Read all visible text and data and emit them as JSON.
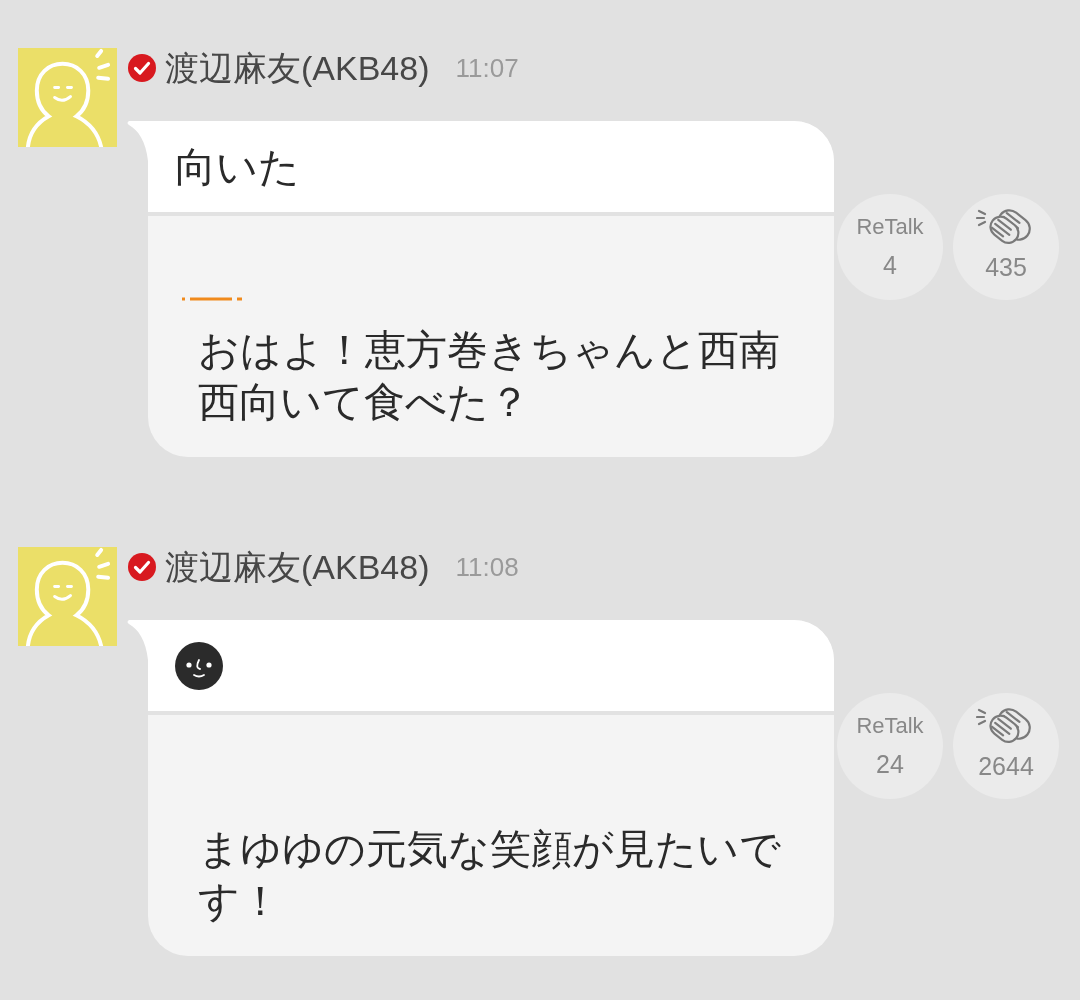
{
  "posts": [
    {
      "author": "渡辺麻友(AKB48)",
      "verified": true,
      "time": "11:07",
      "headline": {
        "kind": "text",
        "text": "向いた"
      },
      "dash_mark": true,
      "body": "おはよ！恵方巻きちゃんと西南西向いて食べた？",
      "retalk": {
        "label": "ReTalk",
        "count": "4"
      },
      "claps": {
        "count": "435"
      }
    },
    {
      "author": "渡辺麻友(AKB48)",
      "verified": true,
      "time": "11:08",
      "headline": {
        "kind": "emoji"
      },
      "dash_mark": false,
      "body": "まゆゆの元気な笑顔が見たいです！",
      "retalk": {
        "label": "ReTalk",
        "count": "24"
      },
      "claps": {
        "count": "2644"
      }
    }
  ]
}
